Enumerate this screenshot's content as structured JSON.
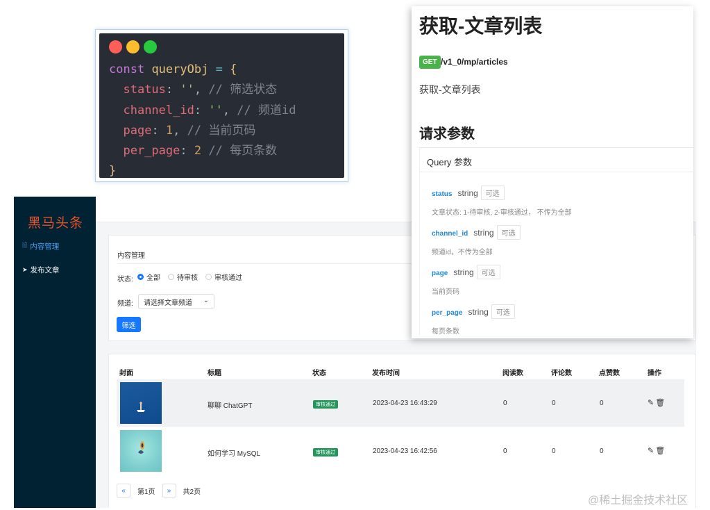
{
  "code": {
    "lines": [
      {
        "kw": "const",
        "var": "queryObj",
        "op": "=",
        "brace": "{"
      },
      {
        "prop": "status",
        "str": "''",
        "cm": "// 筛选状态"
      },
      {
        "prop": "channel_id",
        "str": "''",
        "cm": "// 频道id"
      },
      {
        "prop": "page",
        "num": "1",
        "cm": "// 当前页码"
      },
      {
        "prop": "per_page",
        "num": "2",
        "cm": "// 每页条数"
      },
      {
        "brace": "}"
      }
    ],
    "dots": [
      "#ff5f56",
      "#ffbd2e",
      "#27c93f"
    ]
  },
  "sidebar": {
    "brand": "黑马头条",
    "items": [
      {
        "label": "内容管理",
        "icon": "document-icon"
      },
      {
        "label": "发布文章",
        "icon": "send-icon"
      }
    ]
  },
  "filter": {
    "title": "内容管理",
    "status_label": "状态:",
    "status_options": [
      "全部",
      "待审核",
      "审核通过"
    ],
    "channel_label": "频道:",
    "channel_placeholder": "请选择文章频道",
    "submit_label": "筛选"
  },
  "table": {
    "headers": [
      "封面",
      "标题",
      "状态",
      "发布时间",
      "阅读数",
      "评论数",
      "点赞数",
      "操作"
    ],
    "rows": [
      {
        "title": "聊聊 ChatGPT",
        "status": "审核通过",
        "time": "2023-04-23 16:43:29",
        "reads": "0",
        "comments": "0",
        "likes": "0"
      },
      {
        "title": "如何学习 MySQL",
        "status": "审核通过",
        "time": "2023-04-23 16:42:56",
        "reads": "0",
        "comments": "0",
        "likes": "0"
      }
    ],
    "pager": {
      "prev": "«",
      "current": "第1页",
      "next": "»",
      "total": "共2页"
    }
  },
  "doc": {
    "title": "获取-文章列表",
    "method": "GET",
    "path": "/v1_0/mp/articles",
    "description": "获取-文章列表",
    "params_heading": "请求参数",
    "query_heading": "Query 参数",
    "params": [
      {
        "name": "status",
        "type": "string",
        "optional": "可选",
        "desc": "文章状态: 1-待审核, 2-审核通过， 不传为全部"
      },
      {
        "name": "channel_id",
        "type": "string",
        "optional": "可选",
        "desc": "频道id，不传为全部"
      },
      {
        "name": "page",
        "type": "string",
        "optional": "可选",
        "desc": "当前页码"
      },
      {
        "name": "per_page",
        "type": "string",
        "optional": "可选",
        "desc": "每页条数"
      }
    ]
  },
  "watermark": "@稀土掘金技术社区"
}
